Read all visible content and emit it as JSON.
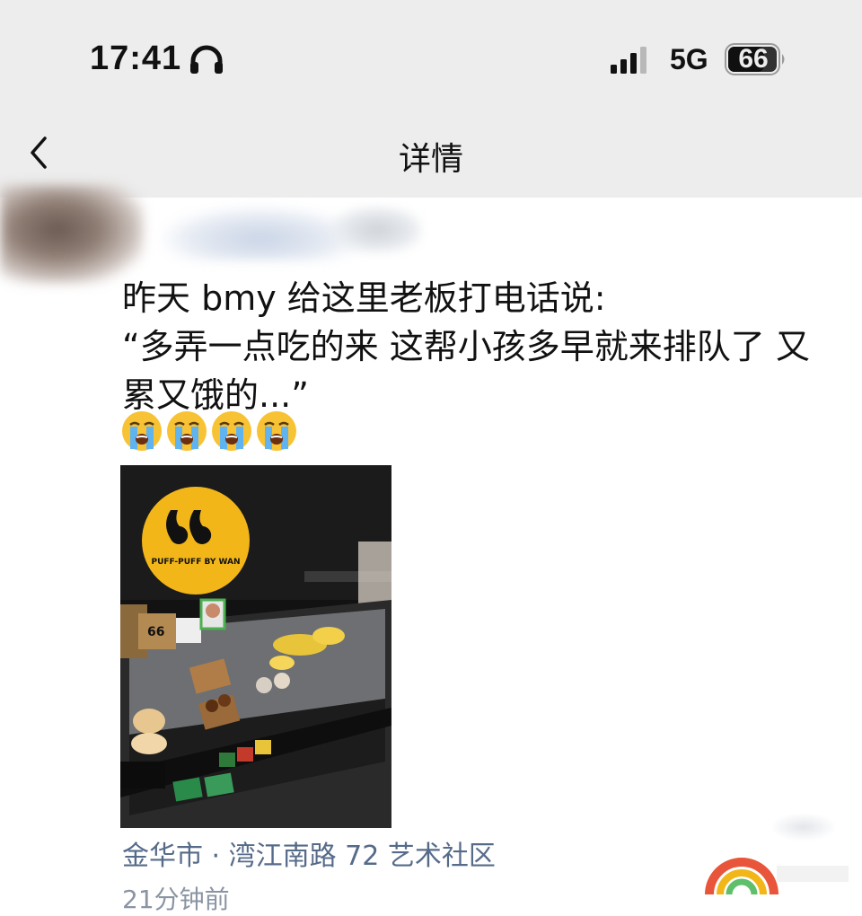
{
  "status_bar": {
    "time": "17:41",
    "network": "5G",
    "battery": "66",
    "headphone_icon": "headphone-icon",
    "signal_icon": "signal-bars-icon"
  },
  "nav": {
    "title": "详情",
    "back_icon": "chevron-left-icon"
  },
  "post": {
    "lines": [
      "昨天 bmy 给这里老板打电话说:",
      "“多弄一点吃的来 这帮小孩多早就来排队了 又",
      "累又饿的...”"
    ],
    "emoji": [
      "loudly-crying-face-icon",
      "loudly-crying-face-icon",
      "loudly-crying-face-icon",
      "loudly-crying-face-icon"
    ],
    "photo": {
      "subject": "pastry display case",
      "sign_text": "PUFF-PUFF BY WAN",
      "logo_colors": {
        "circle": "#f2b619",
        "wall": "#141414"
      }
    },
    "location": "金华市 · 湾江南路 72 艺术社区",
    "time_ago": "21分钟前"
  },
  "colors": {
    "top_background": "#ededed",
    "link_blue": "#566b8a",
    "muted_gray": "#8a94a3"
  }
}
